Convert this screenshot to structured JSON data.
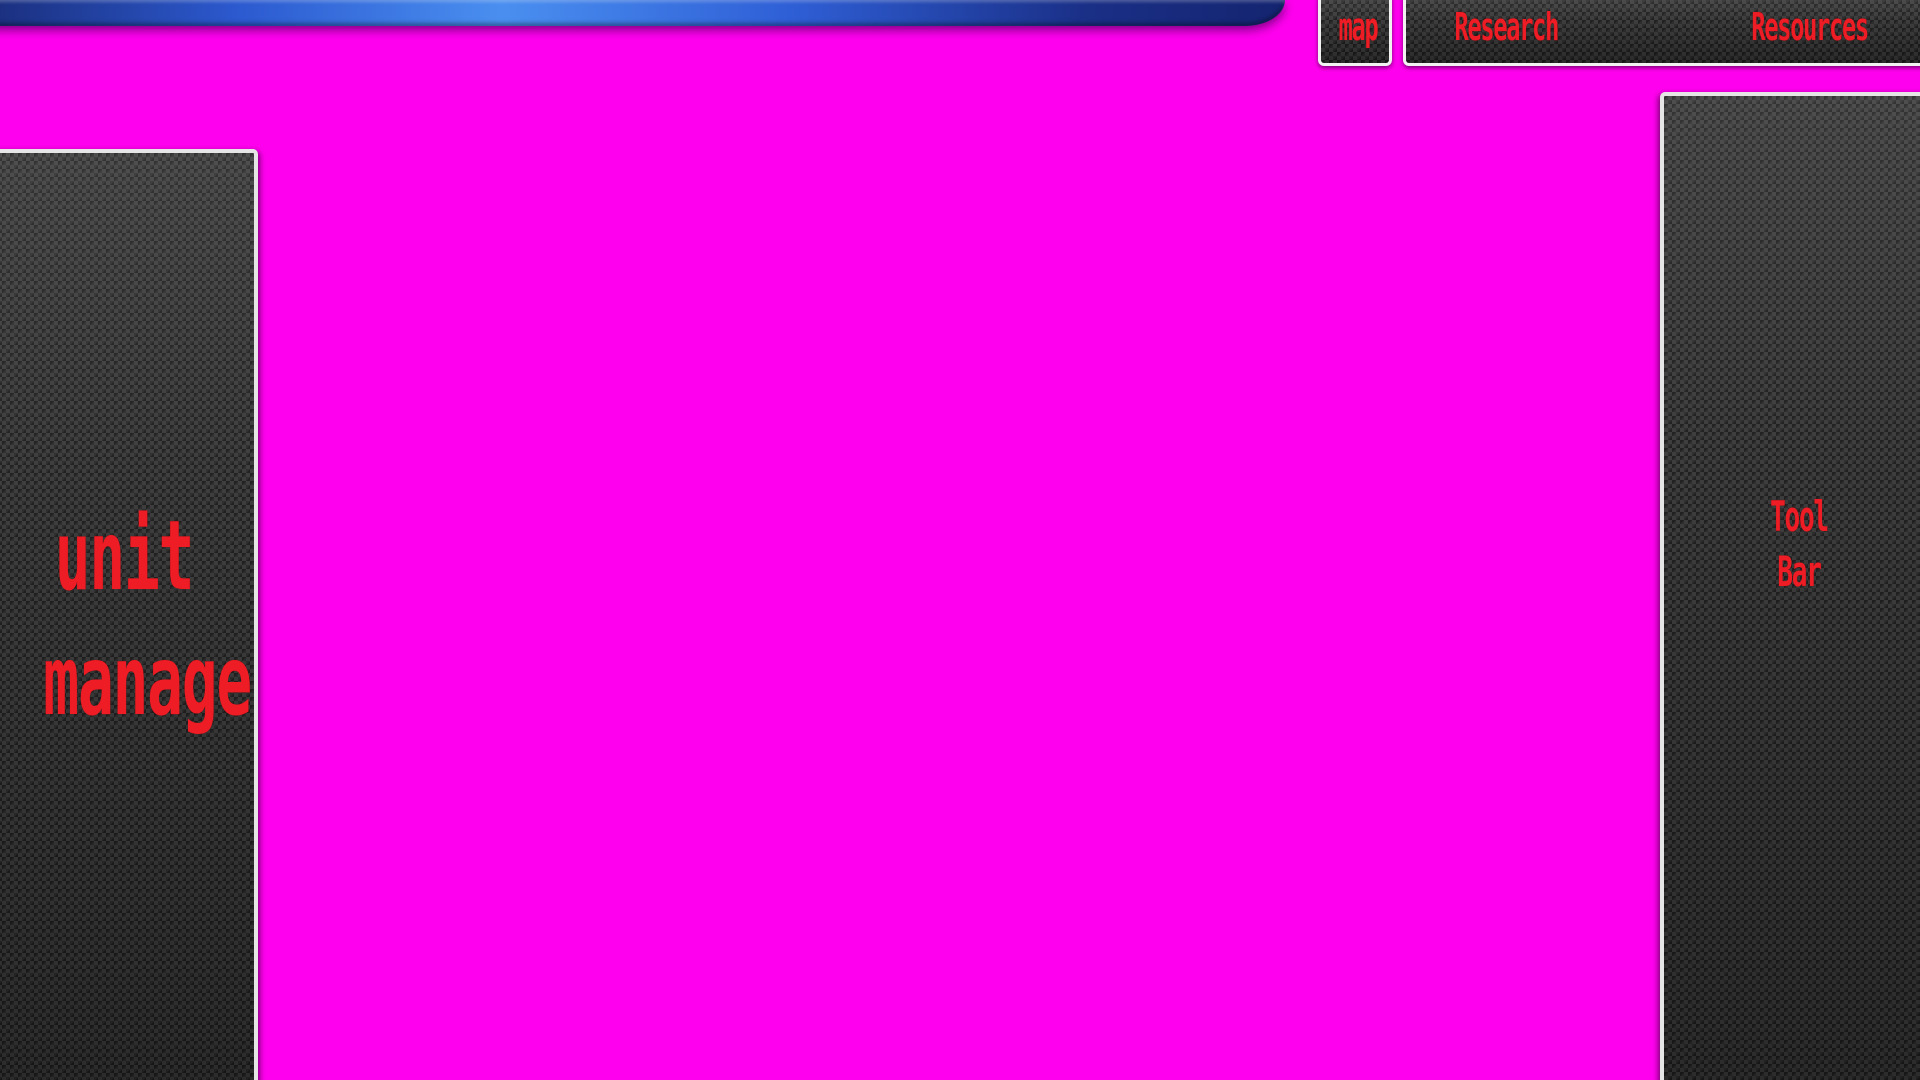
{
  "top_tabs": {
    "map_label": "map",
    "research_label": "Research",
    "resources_label": "Resources"
  },
  "left_panel": {
    "line1": "unit",
    "line2": "manage"
  },
  "right_panel": {
    "line1": "Tool",
    "line2": "Bar"
  },
  "colors": {
    "background": "#ff00ee",
    "label_text": "#ee1c25",
    "top_bar": "#2c5ad0",
    "panel_border": "#e6e6e6"
  }
}
